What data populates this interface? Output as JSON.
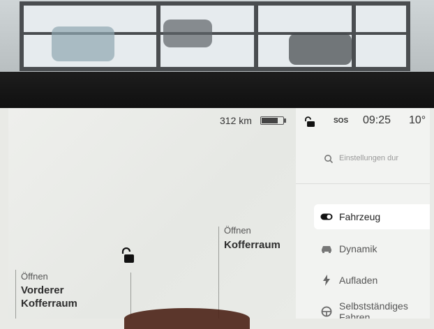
{
  "status": {
    "range": "312 km",
    "battery_level": 0.75,
    "sos": "SOS",
    "time": "09:25",
    "temperature": "10°"
  },
  "vehicle": {
    "trunk_action": "Öffnen",
    "trunk_label": "Kofferraum",
    "frunk_action": "Öffnen",
    "frunk_label_line1": "Vorderer",
    "frunk_label_line2": "Kofferraum"
  },
  "search": {
    "placeholder": "Einstellungen dur"
  },
  "menu": {
    "items": [
      {
        "label": "Fahrzeug",
        "icon": "toggle-icon",
        "active": true
      },
      {
        "label": "Dynamik",
        "icon": "car-icon",
        "active": false
      },
      {
        "label": "Aufladen",
        "icon": "lightning-icon",
        "active": false
      },
      {
        "label": "Selbstständiges Fahren",
        "icon": "steering-wheel-icon",
        "active": false
      }
    ]
  },
  "colors": {
    "bezel": "#101010",
    "screen": "#eceeea",
    "active_item": "#ffffff"
  }
}
